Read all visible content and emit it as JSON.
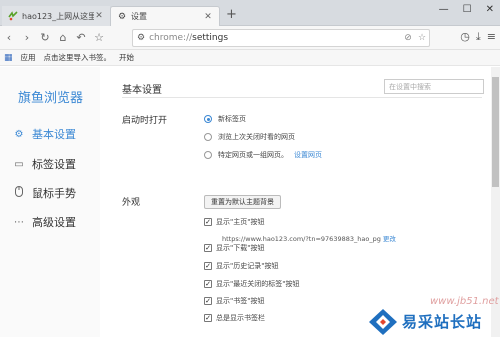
{
  "tabs": [
    {
      "title": "hao123_上网从这里开始",
      "favicon": "hao123-icon"
    },
    {
      "title": "设置",
      "favicon": "gear-icon"
    }
  ],
  "toolbar": {
    "url_scheme": "chrome://",
    "url_path": "settings"
  },
  "bookmarks": {
    "apps_label": "应用",
    "import_label": "点击这里导入书签。",
    "start_label": "开始"
  },
  "sidebar": {
    "brand": "旗鱼浏览器",
    "items": [
      {
        "label": "基本设置",
        "icon": "gear-icon",
        "active": true
      },
      {
        "label": "标签设置",
        "icon": "tab-icon",
        "active": false
      },
      {
        "label": "鼠标手势",
        "icon": "mouse-icon",
        "active": false
      },
      {
        "label": "高级设置",
        "icon": "more-icon",
        "active": false
      }
    ]
  },
  "main": {
    "title": "基本设置",
    "search_placeholder": "在设置中搜索",
    "startup": {
      "label": "启动时打开",
      "options": [
        {
          "label": "新标签页",
          "selected": true
        },
        {
          "label": "浏览上次关闭时看的网页",
          "selected": false
        },
        {
          "label": "特定网页或一组网页。",
          "selected": false,
          "link": "设置网页"
        }
      ]
    },
    "appearance": {
      "label": "外观",
      "reset_button": "重置为默认主题背景",
      "home_url": "https://www.hao123.com/?tn=97639883_hao_pg",
      "change_link": "更改",
      "checkboxes": [
        {
          "label": "显示\"主页\"按钮",
          "checked": true
        },
        {
          "label": "显示\"下载\"按钮",
          "checked": true
        },
        {
          "label": "显示\"历史记录\"按钮",
          "checked": true
        },
        {
          "label": "显示\"最近关闭的标签\"按钮",
          "checked": true
        },
        {
          "label": "显示\"书签\"按钮",
          "checked": true
        },
        {
          "label": "总是显示书签栏",
          "checked": true
        }
      ]
    }
  },
  "watermark": {
    "url": "www.jb51.net",
    "name": "易采站长站"
  },
  "colors": {
    "accent": "#3b88d4"
  }
}
